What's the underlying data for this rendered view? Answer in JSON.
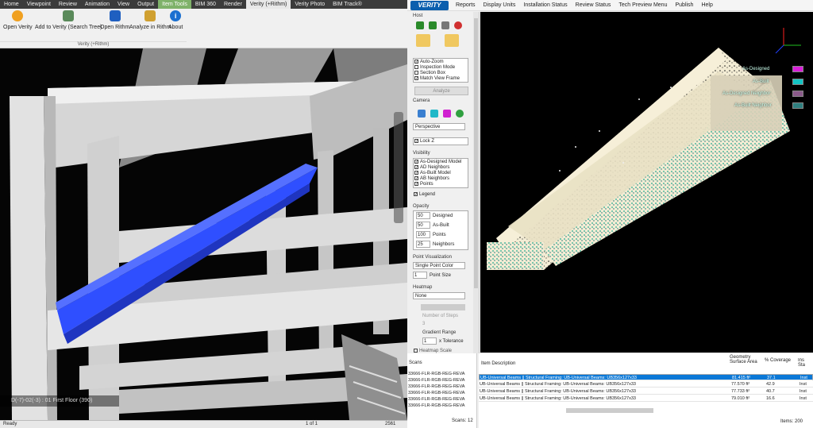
{
  "ribbon_tabs": [
    "Home",
    "Viewpoint",
    "Review",
    "Animation",
    "View",
    "Output",
    "Item Tools",
    "BIM 360",
    "Render",
    "Verity (+Rithm)",
    "Verity Photo",
    "BIM Track®"
  ],
  "ribbon_buttons": [
    "Open Verity",
    "Add to Verity (Search Tree)",
    "Open Rithm",
    "Analyze in Rithm",
    "About"
  ],
  "ribbon_group": "Verity (+Rithm)",
  "viewport_label": "D(-7)-02(-3) : 01 First Floor (390)",
  "status": {
    "left": "Ready",
    "page": "1 of 1",
    "count": "2561"
  },
  "menu": [
    "Reports",
    "Display Units",
    "Installation Status",
    "Review Status",
    "Tech Preview Menu",
    "Publish",
    "Help"
  ],
  "logo": "VERITY",
  "panel": {
    "host": "Host",
    "options": [
      "Auto-Zoom",
      "Inspection Mode",
      "Section Box",
      "Match View Frame"
    ],
    "analyze": "Analyze",
    "camera": "Camera",
    "projection": "Perspective",
    "lockz": "Lock Z",
    "visibility": "Visibility",
    "vis_items": [
      "As-Designed Model",
      "AD Neighbors",
      "As-Built Model",
      "AB Neighbors",
      "Points"
    ],
    "legend": "Legend",
    "opacity": "Opacity",
    "op": [
      {
        "v": "50",
        "l": "Designed"
      },
      {
        "v": "50",
        "l": "As-Built"
      },
      {
        "v": "100",
        "l": "Points"
      },
      {
        "v": "25",
        "l": "Neighbors"
      }
    ],
    "pointvis": "Point Visualization",
    "pointcolor": "Single Point Color",
    "pointsize": "1",
    "pointsize_lbl": "Point Size",
    "heatmap": "Heatmap",
    "heatmap_val": "None",
    "steps_lbl": "Number of Steps",
    "steps": "3",
    "gradient": "Gradient Range",
    "tol": "1",
    "tol_lbl": "x Tolerance",
    "heatmap_scale": "Heatmap Scale"
  },
  "legend3d": [
    "As-Designed",
    "As-Built",
    "As-Designed Neighbor",
    "As-Built Neighbor"
  ],
  "colors": {
    "designed": "#d81fd8",
    "built": "#14c4c4",
    "dn": "#8a5a8a",
    "bn": "#2f7f7f",
    "beam": "#2f4fff",
    "sel": "#0a78d7"
  },
  "scans": {
    "header": "Scans",
    "rows": [
      "33666-FLR-RGB-REG-REVA",
      "33666-FLR-RGB-REG-REVA",
      "33666-FLR-RGB-REG-REVA",
      "33666-FLR-RGB-REG-REVA",
      "33666-FLR-RGB-REG-REVA",
      "33666-FLR-RGB-REG-REVA"
    ],
    "footer": "Scans: 12"
  },
  "table": {
    "headers": [
      "Item Description",
      "Geometry Surface Area",
      "% Coverage",
      "Ins Sta"
    ],
    "rows": [
      {
        "d": "UB-Universal Beams || Structural Framing: UB-Universal Beams: UB356x127x33",
        "a": "81.415 ft²",
        "c": "37.1",
        "s": "Inst"
      },
      {
        "d": "UB-Universal Beams || Structural Framing: UB-Universal Beams: UB356x127x33",
        "a": "77.570 ft²",
        "c": "42.9",
        "s": "Inst"
      },
      {
        "d": "UB-Universal Beams || Structural Framing: UB-Universal Beams: UB356x127x33",
        "a": "77.733 ft²",
        "c": "40.7",
        "s": "Inst"
      },
      {
        "d": "UB-Universal Beams || Structural Framing: UB-Universal Beams: UB356x127x33",
        "a": "79.010 ft²",
        "c": "16.6",
        "s": "Inst"
      }
    ],
    "footer": "Items: 200"
  }
}
